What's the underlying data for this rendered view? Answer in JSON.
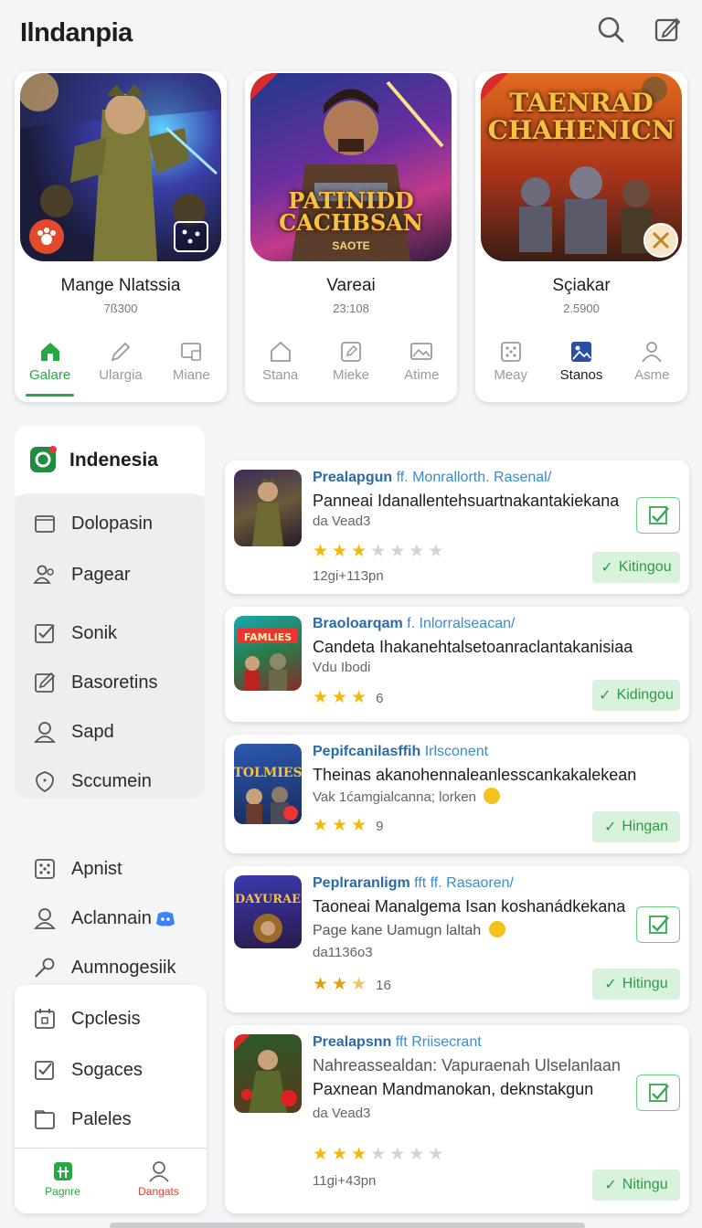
{
  "app": {
    "title": "Ilndanpia"
  },
  "header": {
    "search_icon": "search-icon",
    "compose_icon": "compose-icon"
  },
  "cards": [
    {
      "title": "Mange Nlatssia",
      "meta": "7ß300",
      "art_caption": "",
      "tabs": [
        {
          "label": "Galare",
          "icon": "home-icon",
          "active": true
        },
        {
          "label": "Ulargia",
          "icon": "pen-icon"
        },
        {
          "label": "Miane",
          "icon": "device-icon"
        }
      ]
    },
    {
      "title": "Vareai",
      "meta": "23:108",
      "art_caption": "PATINIDD CACHBSAN",
      "art_sub": "SAOTE",
      "tabs": [
        {
          "label": "Stana",
          "icon": "house-icon"
        },
        {
          "label": "Mieke",
          "icon": "edit-square-icon"
        },
        {
          "label": "Atime",
          "icon": "image-icon"
        }
      ]
    },
    {
      "title": "Sçiakar",
      "meta": "2.5900",
      "art_caption": "TAENRAD CHAHENICN",
      "tabs": [
        {
          "label": "Meay",
          "icon": "dice-icon"
        },
        {
          "label": "Stanos",
          "icon": "gallery-icon",
          "dark": true
        },
        {
          "label": "Asme",
          "icon": "person-icon"
        }
      ]
    }
  ],
  "sidebar": {
    "brand": "Indenesia",
    "group1": [
      {
        "label": "Dolopasin",
        "icon": "folder-icon"
      },
      {
        "label": "Pagear",
        "icon": "users-icon"
      }
    ],
    "group2": [
      {
        "label": "Sonik",
        "icon": "check-square-icon"
      },
      {
        "label": "Basoretins",
        "icon": "edit-square-icon"
      },
      {
        "label": "Sapd",
        "icon": "user-icon"
      },
      {
        "label": "Sccumein",
        "icon": "shield-icon"
      }
    ],
    "group3": [
      {
        "label": "Apnist",
        "icon": "dice-icon"
      },
      {
        "label": "Aclannain",
        "icon": "user-icon"
      },
      {
        "label": "Aumnogesiik",
        "icon": "key-icon"
      }
    ],
    "box_items": [
      {
        "label": "Cpclesis",
        "icon": "calendar-icon"
      },
      {
        "label": "Sogaces",
        "icon": "check-square-icon"
      },
      {
        "label": "Paleles",
        "icon": "folder-icon"
      }
    ],
    "nav": [
      {
        "label": "Pagnre",
        "icon": "home-icon",
        "color": "#27a844"
      },
      {
        "label": "Dangats",
        "icon": "person-icon",
        "color": "#d9412b"
      }
    ]
  },
  "feed": [
    {
      "title": "Prealapgun",
      "title_sub": "ff. Monrallorth. Rasenal/",
      "line1": "Panneai Idanallentehsuartnakantakiekana",
      "line2": "",
      "small": "da Vead3",
      "rating": 3,
      "stars_total": 7,
      "count": "",
      "time": "12gi+113pn",
      "pill": "Kitingou",
      "has_check": true
    },
    {
      "title": "Braoloarqam",
      "title_sub": "f. Inlorralseacan/",
      "line1": "Candeta Ihakanehtalsetoanraclantakanisiaa",
      "line2": "",
      "small": "Vdu Ibodi",
      "rating": 3,
      "stars_total": 3,
      "count": "6",
      "time": "",
      "pill": "Kidingou",
      "has_check": false
    },
    {
      "title": "Pepifcanilasffih",
      "title_sub": "Irlsconent",
      "line1": "Theinas akanohennaleanlesscankakalekean",
      "line2": "",
      "small": "Vak 1ćamgialcanna; lorken",
      "rating": 3,
      "stars_total": 3,
      "count": "9",
      "time": "",
      "pill": "Hingan",
      "has_check": false
    },
    {
      "title": "Peplraranligm",
      "title_sub": "fft ff. Rasaoren/",
      "line1": "Taoneai Manalgema Isan koshanádkekana",
      "line2": "Page kane Uamugn laltah",
      "small": "da1136o3",
      "rating": 2.5,
      "stars_total": 3,
      "count": "16",
      "time": "",
      "pill": "Hitingu",
      "has_check": true
    },
    {
      "title": "Prealapsnn",
      "title_sub": "fft Rriisecrant",
      "line1": "Nahreassealdan: Vapuraenah Ulselanlaan",
      "line2": "Paxnean Mandmanokan, deknstakgun",
      "small": "da Vead3",
      "rating": 3,
      "stars_total": 7,
      "count": "",
      "time": "11gi+43pn",
      "pill": "Nitingu",
      "has_check": true
    }
  ],
  "colors": {
    "accent_green": "#27a844",
    "link_blue": "#2a6aa8",
    "star": "#f2b90d"
  }
}
